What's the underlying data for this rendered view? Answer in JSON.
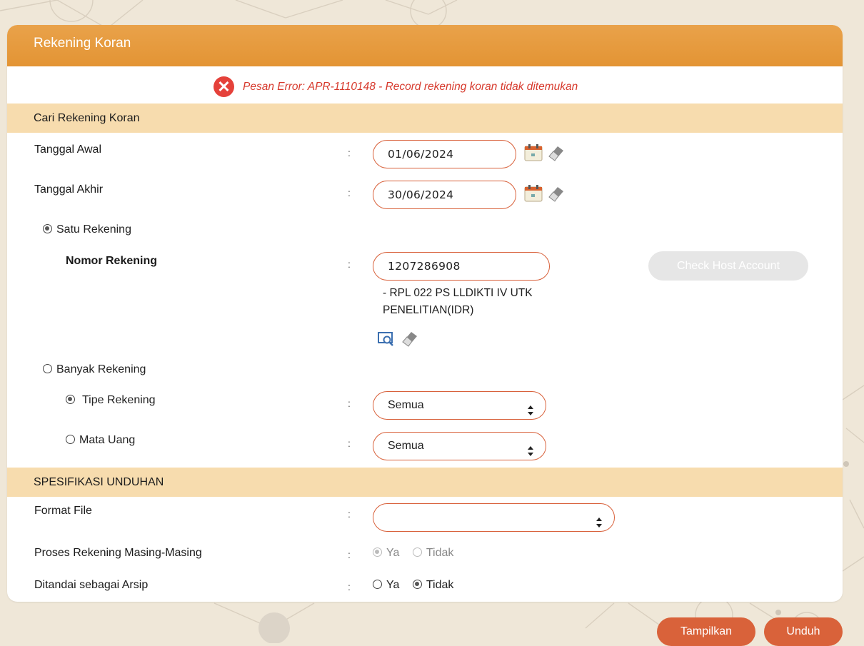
{
  "panel": {
    "title": "Rekening Koran",
    "error_message": "Pesan Error: APR-1110148 - Record rekening koran tidak ditemukan"
  },
  "search_section": {
    "title": "Cari Rekening Koran",
    "start_date_label": "Tanggal Awal",
    "start_date_value": "01/06/2024",
    "end_date_label": "Tanggal Akhir",
    "end_date_value": "30/06/2024",
    "single_account_label": "Satu Rekening",
    "account_number_label": "Nomor Rekening",
    "account_number_value": "1207286908",
    "account_name_line1": "- RPL 022 PS LLDIKTI IV UTK",
    "account_name_line2": "PENELITIAN(IDR)",
    "check_host_button": "Check Host Account",
    "multi_account_label": "Banyak Rekening",
    "account_type_label": "Tipe Rekening",
    "account_type_value": "Semua",
    "currency_label": "Mata Uang",
    "currency_value": "Semua",
    "colon": ":"
  },
  "download_section": {
    "title": "SPESIFIKASI UNDUHAN",
    "format_label": "Format File",
    "format_value": "",
    "process_label": "Proses Rekening Masing-Masing",
    "archive_label": "Ditandai sebagai Arsip",
    "yes": "Ya",
    "no": "Tidak"
  },
  "actions": {
    "show_button": "Tampilkan",
    "download_button": "Unduh"
  },
  "radios": {
    "single_account": true,
    "account_type": true,
    "process_yes": true,
    "archive_no": true
  },
  "colors": {
    "header": "#e39434",
    "section": "#f7dcae",
    "accent": "#d9623a",
    "error": "#d73a2d"
  },
  "icons": [
    "calendar-icon",
    "eraser-icon",
    "search-icon",
    "close-icon"
  ]
}
